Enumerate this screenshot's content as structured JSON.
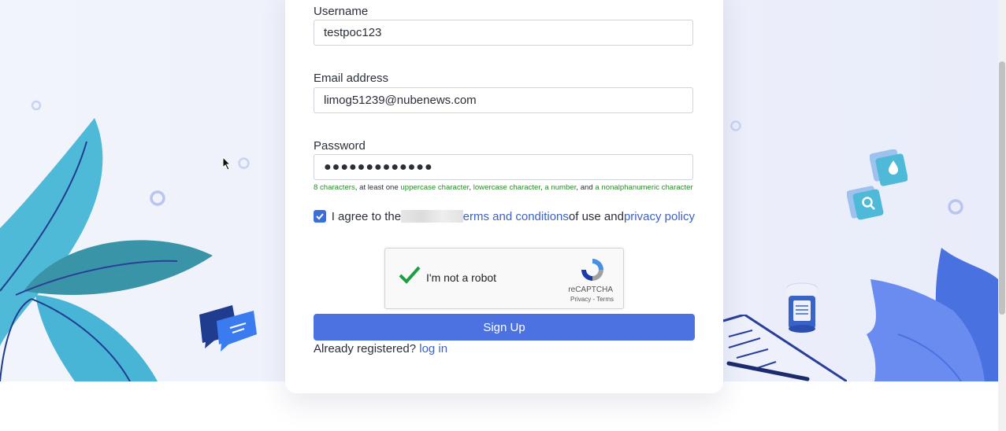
{
  "form": {
    "username_label": "Username",
    "username_value": "testpoc123",
    "email_label": "Email address",
    "email_value": "limog51239@nubenews.com",
    "password_label": "Password",
    "password_value": "●●●●●●●●●●●●●"
  },
  "password_hint": {
    "part1": "8 characters",
    "part2": ", at least one ",
    "part3": "uppercase character",
    "part4": ", ",
    "part5": "lowercase character",
    "part6": ", ",
    "part7": "a number",
    "part8": ", and ",
    "part9": "a nonalphanumeric character"
  },
  "agreement": {
    "checked": true,
    "prefix": "I agree to the ",
    "terms_link": "erms and conditions",
    "middle": " of use and ",
    "privacy_link": "privacy policy"
  },
  "captcha": {
    "label": "I'm not a robot",
    "brand": "reCAPTCHA",
    "links": "Privacy - Terms"
  },
  "signup_button": "Sign Up",
  "footer": {
    "already_text": "Already registered? ",
    "login_link": "log in"
  },
  "colors": {
    "primary": "#4b72e0",
    "link": "#3b62c8",
    "hint_ok": "#2a8a2a"
  }
}
